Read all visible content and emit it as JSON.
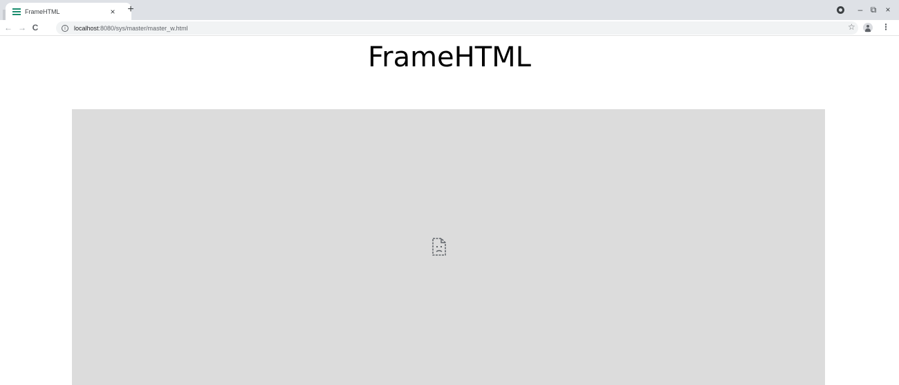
{
  "browser": {
    "tab": {
      "title": "FrameHTML",
      "close_label": "×"
    },
    "new_tab_label": "+",
    "window_controls": {
      "minimize": "–",
      "restore": "⧉",
      "close": "×"
    },
    "nav": {
      "back": "←",
      "forward": "→",
      "reload": "C"
    },
    "address": {
      "host": "localhost",
      "port_path": ":8080/sys/master/master_w.html"
    },
    "info_label": "i",
    "star": "☆",
    "menu": "⋮"
  },
  "page": {
    "heading": "FrameHTML",
    "frame_icon": "sad-document-icon"
  },
  "colors": {
    "tabstrip": "#dee1e6",
    "frame_bg": "#dcdcdc",
    "favicon": "#1a8c6e"
  }
}
